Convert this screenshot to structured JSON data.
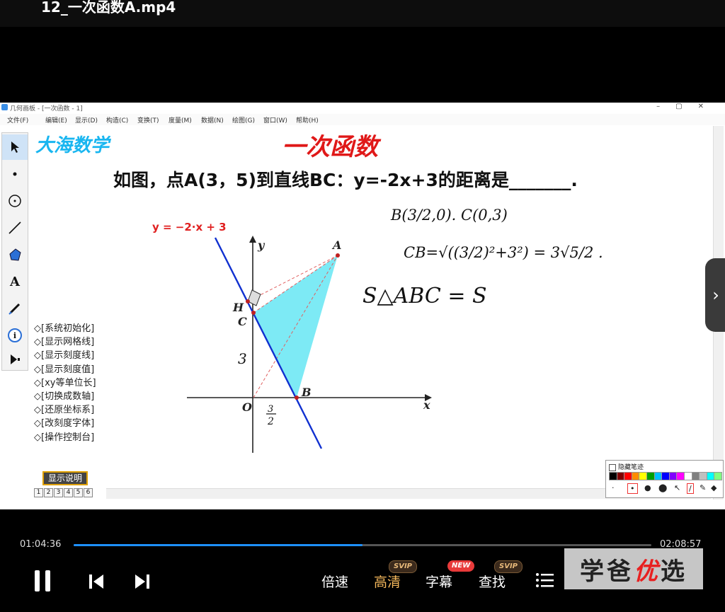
{
  "player": {
    "title": "12_一次函数A.mp4",
    "time_current": "01:04:36",
    "time_total": "02:08:57",
    "progress_fraction": 0.5,
    "options": [
      {
        "label": "倍速",
        "badge": "",
        "active": false
      },
      {
        "label": "高清",
        "badge": "SVIP",
        "active": true
      },
      {
        "label": "字幕",
        "badge": "NEW",
        "active": false
      },
      {
        "label": "查找",
        "badge": "SVIP",
        "active": false
      }
    ],
    "watermark": {
      "part1": "学爸",
      "part2": "优",
      "part3": "选"
    }
  },
  "app": {
    "title": "几何画板 - [一次函数 - 1]",
    "menu": [
      "文件(F)",
      "编辑(E)",
      "显示(D)",
      "构造(C)",
      "变换(T)",
      "度量(M)",
      "数据(N)",
      "绘图(G)",
      "窗口(W)",
      "帮助(H)"
    ],
    "brand": "大海数学",
    "lesson_title": "一次函数",
    "question": "如图，点A(3，5)到直线BC：y=-2x+3的距离是_______.",
    "commands": [
      "◇[系统初始化]",
      "◇[显示网格线]",
      "◇[显示刻度线]",
      "◇[显示刻度值]",
      "◇[xy等单位长]",
      "◇[切换成数轴]",
      "◇[还原坐标系]",
      "◇[改刻度字体]",
      "◇[操作控制台]"
    ],
    "show_button": "显示说明",
    "pages": [
      "1",
      "2",
      "3",
      "4",
      "5",
      "6"
    ],
    "pen_panel": {
      "label": "隐藏笔迹",
      "colors": [
        "#000000",
        "#7f0000",
        "#ff0000",
        "#ff8c00",
        "#ffff00",
        "#00a000",
        "#00c0ff",
        "#0000ff",
        "#8000ff",
        "#ff00ff",
        "#ffffff",
        "#808080",
        "#c0c0c0",
        "#00ffff",
        "#80ff80"
      ]
    }
  },
  "figure": {
    "line_label": "y = −2·x + 3",
    "axis_x": "x",
    "axis_y": "y",
    "origin": "O",
    "points": {
      "A": "A",
      "B": "B",
      "C": "C",
      "H": "H"
    },
    "seg_label_3": "3",
    "frac_num": "3",
    "frac_den": "2"
  },
  "handwriting": {
    "line1": "B(3/2,0).  C(0,3)",
    "line2": "CB=√((3/2)²+3²) = 3√5/2 .",
    "line3": "S△ABC = S"
  }
}
